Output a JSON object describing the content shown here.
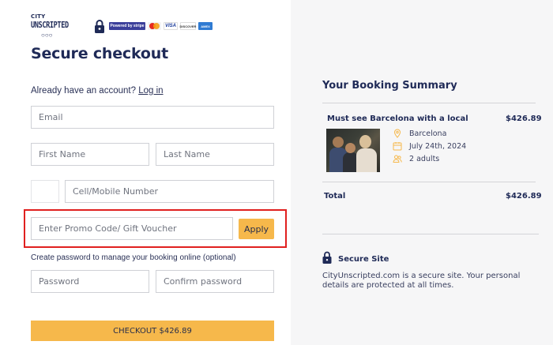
{
  "header": {
    "brand_top": "CITY",
    "brand_main": "UNSCRIPTED",
    "brand_dots": "○○○",
    "stripe_label": "Powered by stripe",
    "mastercard_label": "MasterCard",
    "visa_label": "VISA",
    "discover_label": "DISCOVER",
    "amex_label": "AMEX"
  },
  "page_title": "Secure checkout",
  "account": {
    "prompt": "Already have an account?",
    "login_link": "Log in"
  },
  "form": {
    "email_placeholder": "Email",
    "first_name_placeholder": "First Name",
    "last_name_placeholder": "Last Name",
    "phone_placeholder": "Cell/Mobile Number",
    "promo_placeholder": "Enter Promo Code/ Gift Voucher",
    "apply_label": "Apply",
    "password_note": "Create password to manage your booking online (optional)",
    "password_placeholder": "Password",
    "confirm_password_placeholder": "Confirm password",
    "checkout_label": "CHECKOUT $426.89"
  },
  "summary": {
    "title": "Your Booking Summary",
    "tour_name": "Must see Barcelona with a local",
    "tour_price": "$426.89",
    "location": "Barcelona",
    "date": "July 24th, 2024",
    "guests": "2 adults",
    "total_label": "Total",
    "total_price": "$426.89",
    "secure_title": "Secure Site",
    "secure_text": "CityUnscripted.com is a secure site. Your personal details are protected at all times."
  },
  "colors": {
    "accent": "#f6b84b",
    "navy": "#1f2a57",
    "highlight": "#e0201f",
    "panel": "#f6f6f7"
  },
  "icons": [
    "lock-icon",
    "location-pin-icon",
    "calendar-icon",
    "users-icon"
  ]
}
